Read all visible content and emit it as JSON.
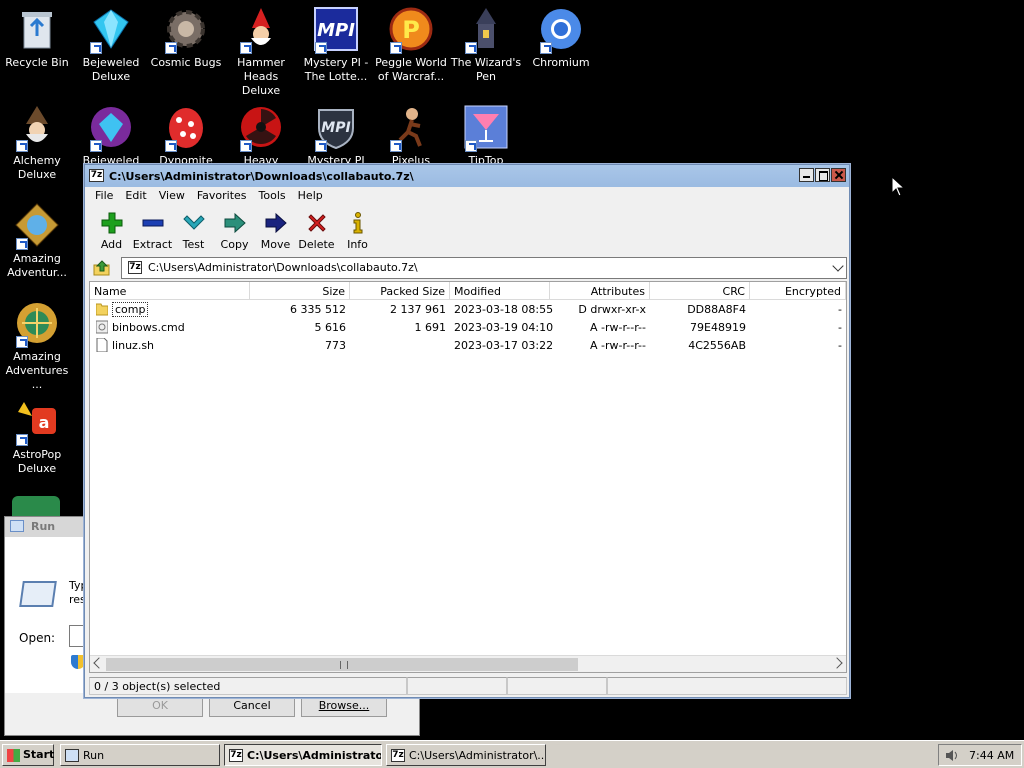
{
  "desktop": {
    "icons": [
      {
        "label": "Recycle Bin",
        "icon": "recycle-bin-icon"
      },
      {
        "label": "Bejeweled Deluxe",
        "icon": "gem-icon"
      },
      {
        "label": "Cosmic Bugs",
        "icon": "gear-bug-icon"
      },
      {
        "label": "Hammer Heads Deluxe",
        "icon": "gnome-icon"
      },
      {
        "label": "Mystery PI - The Lotte...",
        "icon": "mpi-logo-icon"
      },
      {
        "label": "Peggle World of Warcraf...",
        "icon": "peggle-icon"
      },
      {
        "label": "The Wizard's Pen",
        "icon": "tower-icon"
      },
      {
        "label": "Chromium",
        "icon": "chromium-icon"
      },
      {
        "label": "Alchemy Deluxe",
        "icon": "wizard-icon"
      },
      {
        "label": "Bejeweled",
        "icon": "gem-ring-icon"
      },
      {
        "label": "Dynomite",
        "icon": "egg-icon"
      },
      {
        "label": "Heavy",
        "icon": "radiation-icon"
      },
      {
        "label": "Mystery PI",
        "icon": "mpi-shield-icon"
      },
      {
        "label": "Pixelus Deluxe",
        "icon": "runner-icon"
      },
      {
        "label": "TipTop Deluxe",
        "icon": "cocktail-icon"
      },
      {
        "label": "Amazing Adventur...",
        "icon": "compass-icon"
      },
      {
        "label": "Amazing Adventures ...",
        "icon": "globe-compass-icon"
      },
      {
        "label": "AstroPop Deluxe",
        "icon": "astropop-icon"
      }
    ]
  },
  "run_dialog": {
    "title": "Run",
    "text_line1": "Typ",
    "text_line2": "res",
    "open_label": "Open:",
    "ok_label": "OK",
    "cancel_label": "Cancel",
    "browse_label": "Browse..."
  },
  "sevenzip": {
    "title": "C:\\Users\\Administrator\\Downloads\\collabauto.7z\\",
    "app_icon_text": "7z",
    "menu": [
      "File",
      "Edit",
      "View",
      "Favorites",
      "Tools",
      "Help"
    ],
    "toolbar": [
      {
        "label": "Add",
        "icon": "add-plus-icon",
        "color": "#1ea01e"
      },
      {
        "label": "Extract",
        "icon": "extract-minus-icon",
        "color": "#1c3fb3"
      },
      {
        "label": "Test",
        "icon": "test-check-icon",
        "color": "#29a7b8"
      },
      {
        "label": "Copy",
        "icon": "copy-arrow-icon",
        "color": "#2b8f7a"
      },
      {
        "label": "Move",
        "icon": "move-arrow-icon",
        "color": "#1a237e"
      },
      {
        "label": "Delete",
        "icon": "delete-x-icon",
        "color": "#d42020"
      },
      {
        "label": "Info",
        "icon": "info-icon",
        "color": "#d9b200"
      }
    ],
    "address": "C:\\Users\\Administrator\\Downloads\\collabauto.7z\\",
    "columns": [
      "Name",
      "Size",
      "Packed Size",
      "Modified",
      "Attributes",
      "CRC",
      "Encrypted"
    ],
    "rows": [
      {
        "name": "comp",
        "size": "6 335 512",
        "packed": "2 137 961",
        "modified": "2023-03-18 08:55",
        "attributes": "D drwxr-xr-x",
        "crc": "DD88A8F4",
        "encrypted": "-",
        "type": "folder"
      },
      {
        "name": "binbows.cmd",
        "size": "5 616",
        "packed": "1 691",
        "modified": "2023-03-19 04:10",
        "attributes": "A -rw-r--r--",
        "crc": "79E48919",
        "encrypted": "-",
        "type": "cmd"
      },
      {
        "name": "linuz.sh",
        "size": "773",
        "packed": "",
        "modified": "2023-03-17 03:22",
        "attributes": "A -rw-r--r--",
        "crc": "4C2556AB",
        "encrypted": "-",
        "type": "file"
      }
    ],
    "status": "0 / 3 object(s) selected"
  },
  "taskbar": {
    "start_label": "Start",
    "tasks": [
      {
        "label": "Run",
        "icon": "run-icon"
      },
      {
        "label": "C:\\Users\\Administrator...",
        "icon": "7z-icon"
      },
      {
        "label": "C:\\Users\\Administrator\\...",
        "icon": "7z-icon"
      }
    ],
    "time": "7:44 AM"
  }
}
